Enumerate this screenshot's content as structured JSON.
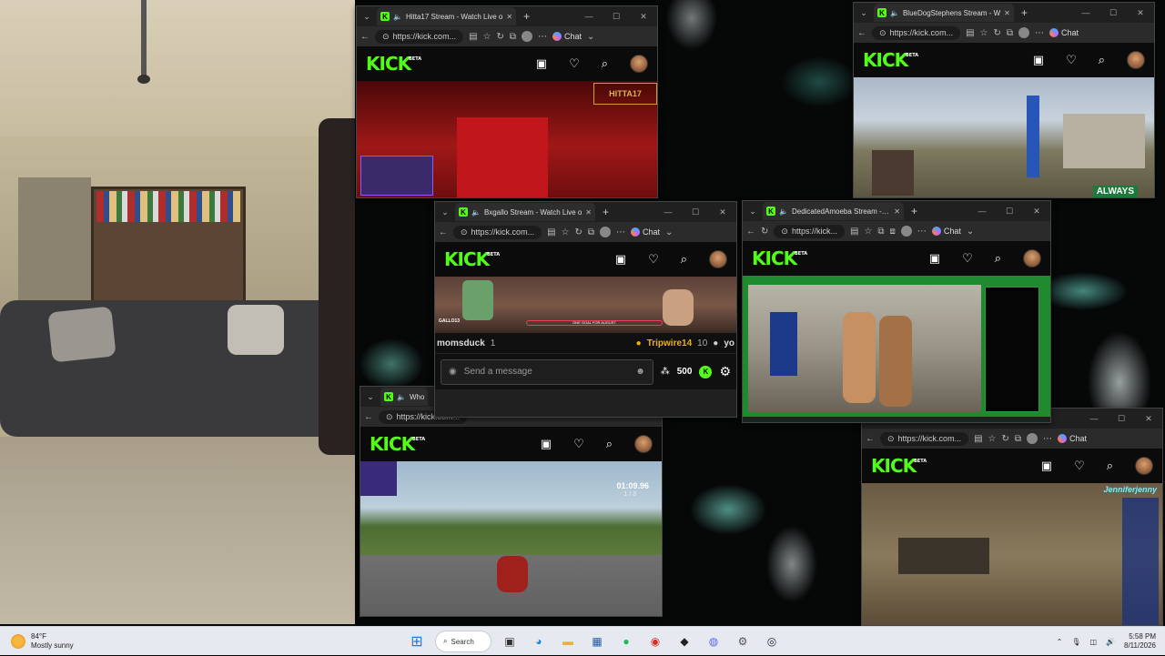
{
  "windows": [
    {
      "id": "w1",
      "tab_title": "Hitta17 Stream - Watch Live o",
      "url": "https://kick.com..."
    },
    {
      "id": "w2",
      "tab_title": "BlueDogStephens Stream - W",
      "url": "https://kick.com..."
    },
    {
      "id": "w3",
      "tab_title": "Bxgallo Stream - Watch Live o",
      "url": "https://kick.com...",
      "chat_users": [
        "momsduck",
        "1",
        "Tripwire14",
        "10",
        "yo"
      ],
      "chat_placeholder": "Send a message",
      "points": "500"
    },
    {
      "id": "w4",
      "tab_title": "DedicatedAmoeba Stream - W",
      "url": "https://kick..."
    },
    {
      "id": "w5",
      "tab_title": "Who",
      "url": "https://kick.com..."
    },
    {
      "id": "w6",
      "tab_title": "",
      "url": "https://kick.com..."
    }
  ],
  "common": {
    "chat_label": "Chat",
    "logo": "KICK",
    "logo_beta": "BETA"
  },
  "overlays": {
    "always_label": "ALWAYS",
    "race_timer": "01:09.96",
    "race_lap": "1 / 3",
    "streamer_tag": "Jenniferjenny",
    "bxgallo_tag": "GALLO13",
    "goal_text": "ONE GOAL FOR AUGUST"
  },
  "taskbar": {
    "temp": "84°F",
    "weather": "Mostly sunny",
    "search_label": "Search",
    "time": "5:58 PM",
    "date": "8/11/2026"
  }
}
